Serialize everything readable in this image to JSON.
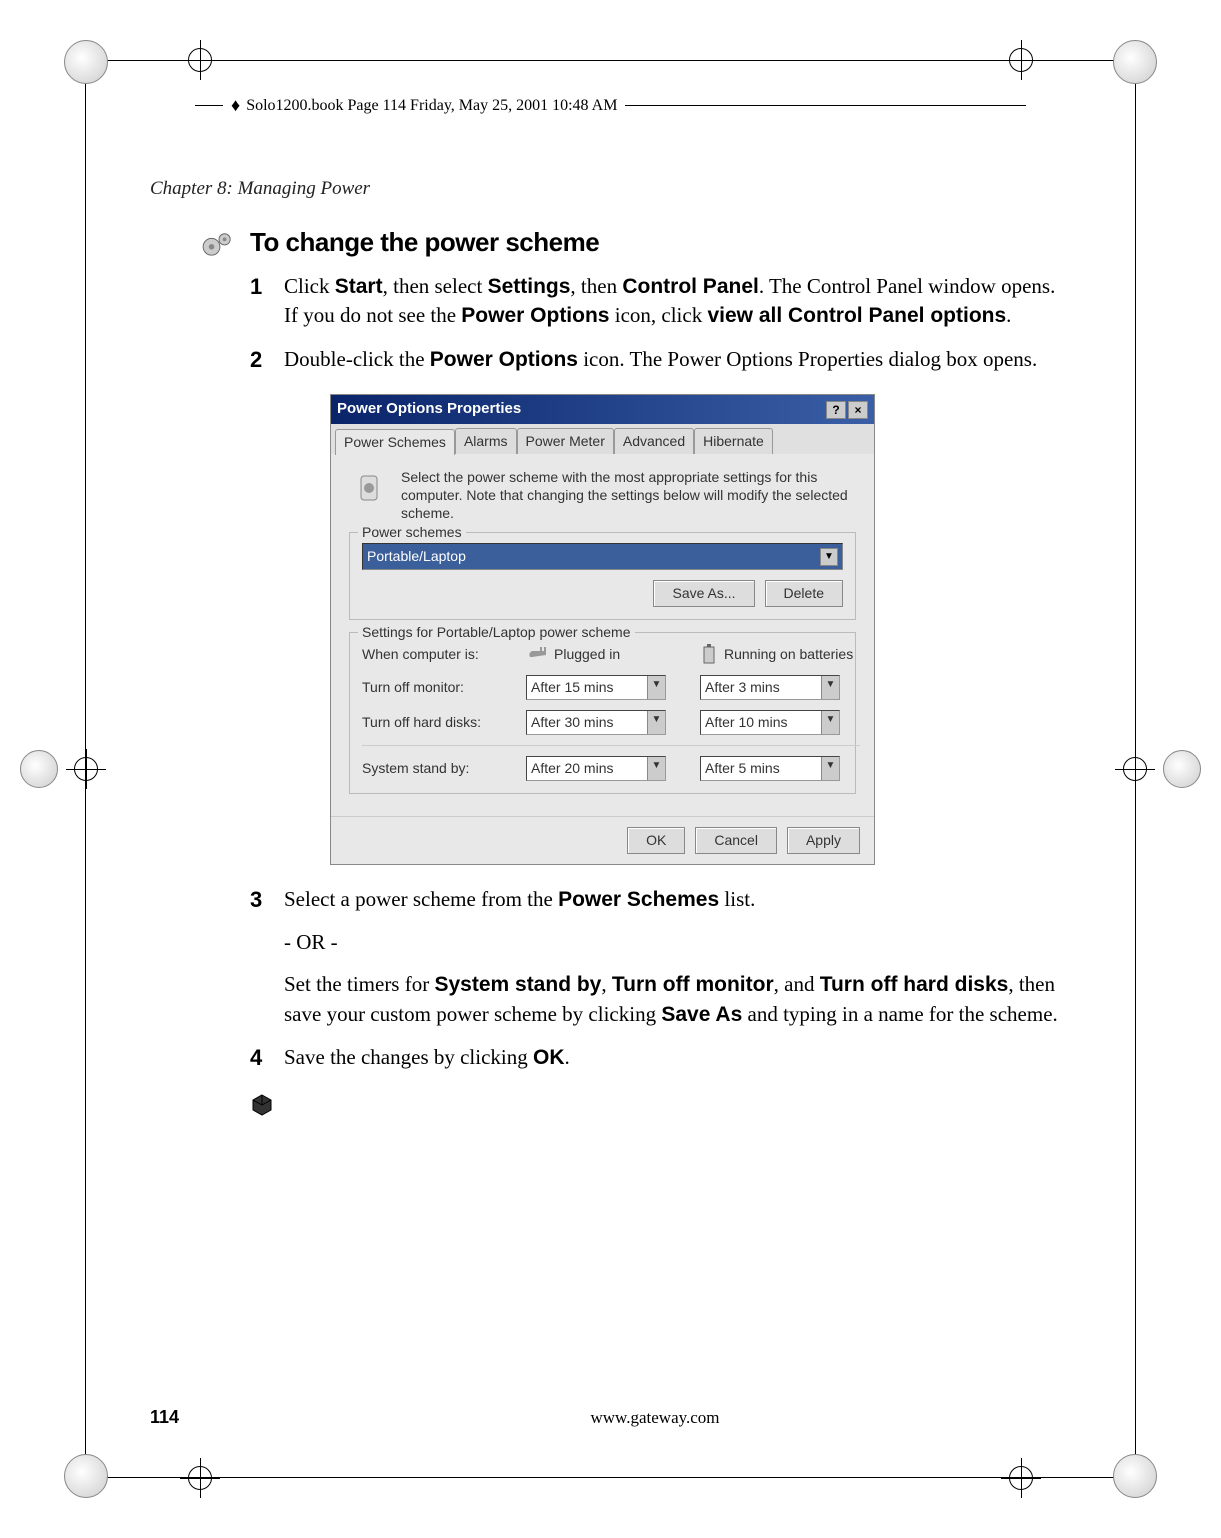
{
  "header_meta": "Solo1200.book  Page 114  Friday, May 25, 2001  10:48 AM",
  "running_head": "Chapter 8: Managing Power",
  "section_title": "To change the power scheme",
  "steps": {
    "1": {
      "num": "1",
      "pre": "Click ",
      "b1": "Start",
      "mid1": ", then select ",
      "b2": "Settings",
      "mid2": ", then ",
      "b3": "Control Panel",
      "mid3": ". The Control Panel window opens. If you do not see the ",
      "b4": "Power Options",
      "mid4": " icon, click ",
      "b5": "view all Control Panel options",
      "post": "."
    },
    "2": {
      "num": "2",
      "pre": "Double-click the ",
      "b1": "Power Options",
      "post": " icon. The Power Options Properties dialog box opens."
    },
    "3": {
      "num": "3",
      "pre": "Select a power scheme from the ",
      "b1": "Power Schemes",
      "post": " list.",
      "or": "- OR -",
      "sub_pre": "Set the timers for ",
      "sb1": "System stand by",
      "sc1": ", ",
      "sb2": "Turn off monitor",
      "sc2": ", and ",
      "sb3": "Turn off hard disks",
      "sc3": ", then save your custom power scheme by clicking ",
      "sb4": "Save As",
      "sc4": " and typing in a name for the scheme."
    },
    "4": {
      "num": "4",
      "pre": "Save the changes by clicking ",
      "b1": "OK",
      "post": "."
    }
  },
  "dialog": {
    "title": "Power Options Properties",
    "help": "?",
    "close": "×",
    "tabs": [
      "Power Schemes",
      "Alarms",
      "Power Meter",
      "Advanced",
      "Hibernate"
    ],
    "info": "Select the power scheme with the most appropriate settings for this computer. Note that changing the settings below will modify the selected scheme.",
    "schemes_legend": "Power schemes",
    "scheme_value": "Portable/Laptop",
    "save_as": "Save As...",
    "delete": "Delete",
    "settings_legend": "Settings for Portable/Laptop power scheme",
    "when_label": "When computer is:",
    "plugged": "Plugged in",
    "batteries": "Running on batteries",
    "monitor_label": "Turn off monitor:",
    "monitor_ac": "After 15 mins",
    "monitor_dc": "After 3 mins",
    "disks_label": "Turn off hard disks:",
    "disks_ac": "After 30 mins",
    "disks_dc": "After 10 mins",
    "standby_label": "System stand by:",
    "standby_ac": "After 20 mins",
    "standby_dc": "After 5 mins",
    "ok": "OK",
    "cancel": "Cancel",
    "apply": "Apply"
  },
  "footer": {
    "page": "114",
    "url": "www.gateway.com"
  }
}
